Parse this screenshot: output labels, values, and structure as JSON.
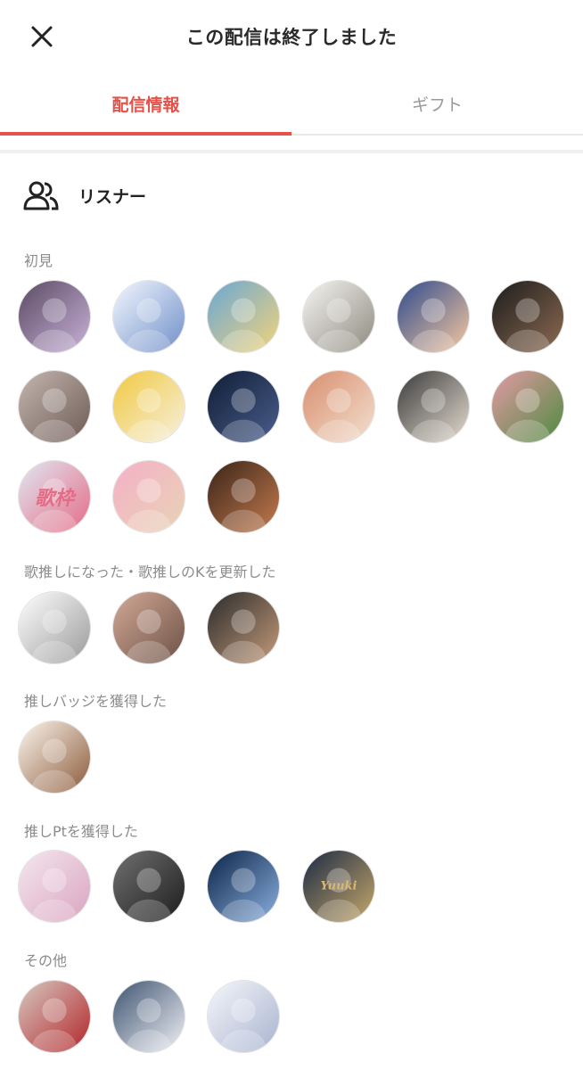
{
  "header": {
    "title": "この配信は終了しました"
  },
  "tabs": [
    {
      "label": "配信情報",
      "active": true
    },
    {
      "label": "ギフト",
      "active": false
    }
  ],
  "listeners": {
    "title": "リスナー"
  },
  "sections": [
    {
      "label": "初見",
      "avatars": [
        {
          "colors": [
            "#5a4a63",
            "#c9b2d9"
          ],
          "text": ""
        },
        {
          "colors": [
            "#f4f8ff",
            "#6f8fc9"
          ],
          "text": ""
        },
        {
          "colors": [
            "#6aa7d6",
            "#f2d37a"
          ],
          "text": ""
        },
        {
          "colors": [
            "#f7f5f1",
            "#8d8a80"
          ],
          "text": ""
        },
        {
          "colors": [
            "#2f4b8d",
            "#f6c8a0"
          ],
          "text": ""
        },
        {
          "colors": [
            "#1c1c1c",
            "#8d6b52"
          ],
          "text": ""
        },
        {
          "colors": [
            "#c5b6b0",
            "#6d5b55"
          ],
          "text": ""
        },
        {
          "colors": [
            "#f0c940",
            "#f7f0e0"
          ],
          "text": ""
        },
        {
          "colors": [
            "#0f1d35",
            "#4b5e8d"
          ],
          "text": ""
        },
        {
          "colors": [
            "#d98f6f",
            "#f2e0d0"
          ],
          "text": ""
        },
        {
          "colors": [
            "#3b3b3b",
            "#e5dcd0"
          ],
          "text": ""
        },
        {
          "colors": [
            "#e39aa5",
            "#4e8a3f"
          ],
          "text": ""
        },
        {
          "colors": [
            "#dfe7f2",
            "#e56c86"
          ],
          "text": "歌枠"
        },
        {
          "colors": [
            "#f5b0c8",
            "#e8d3b4"
          ],
          "text": ""
        },
        {
          "colors": [
            "#3a2418",
            "#c47b4e"
          ],
          "text": ""
        }
      ]
    },
    {
      "label": "歌推しになった・歌推しのKを更新した",
      "avatars": [
        {
          "colors": [
            "#ffffff",
            "#9a9a9a"
          ],
          "text": ""
        },
        {
          "colors": [
            "#d3a896",
            "#6c5246"
          ],
          "text": ""
        },
        {
          "colors": [
            "#2b2b2b",
            "#c49b7a"
          ],
          "text": ""
        }
      ]
    },
    {
      "label": "推しバッジを獲得した",
      "avatars": [
        {
          "colors": [
            "#fbf6ee",
            "#8c5a3a"
          ],
          "text": ""
        }
      ]
    },
    {
      "label": "推しPtを獲得した",
      "avatars": [
        {
          "colors": [
            "#f5e7ef",
            "#d9a4c0"
          ],
          "text": ""
        },
        {
          "colors": [
            "#707070",
            "#1d1d1d"
          ],
          "text": ""
        },
        {
          "colors": [
            "#0b2447",
            "#8bb0e0"
          ],
          "text": ""
        },
        {
          "colors": [
            "#1b2a45",
            "#c7a86a"
          ],
          "text": "Yuuki"
        }
      ]
    },
    {
      "label": "その他",
      "avatars": [
        {
          "colors": [
            "#d6c8c0",
            "#b3262a"
          ],
          "text": ""
        },
        {
          "colors": [
            "#3e5470",
            "#f1f1f6"
          ],
          "text": ""
        },
        {
          "colors": [
            "#f6f7fb",
            "#a7b3cf"
          ],
          "text": ""
        }
      ]
    }
  ],
  "icons": {
    "close": "close-icon",
    "listeners": "people-icon"
  },
  "accent_color": "#e4534a"
}
